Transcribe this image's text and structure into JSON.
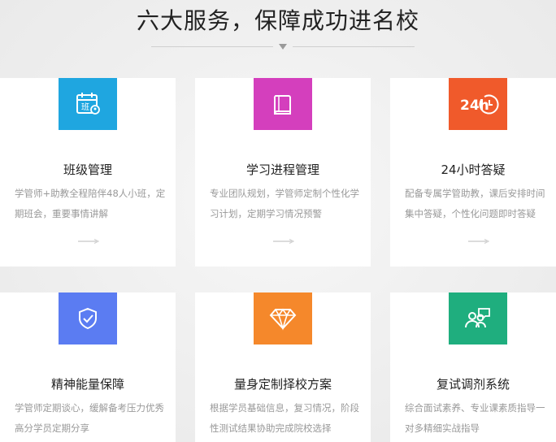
{
  "header": {
    "title": "六大服务，保障成功进名校"
  },
  "colors": {
    "cyan": "#1fa6e0",
    "magenta": "#d43fbd",
    "orange_red": "#f05a2b",
    "blue": "#5b7cf2",
    "orange": "#f5882b",
    "green": "#1fae7e"
  },
  "services": [
    {
      "name": "班级管理",
      "desc": "学管师+助教全程陪伴48人小班，定期班会，重要事情讲解",
      "icon": "class-calendar-icon",
      "icon_text": "班"
    },
    {
      "name": "学习进程管理",
      "desc": "专业团队规划，学管师定制个性化学习计划，定期学习情况预警",
      "icon": "book-icon"
    },
    {
      "name": "24小时答疑",
      "desc": "配备专属学管助教，课后安排时间集中答疑，个性化问题即时答疑",
      "icon": "clock-24h-icon",
      "icon_text": "24h"
    },
    {
      "name": "精神能量保障",
      "desc": "学管师定期谈心，缓解备考压力优秀高分学员定期分享",
      "icon": "shield-check-icon"
    },
    {
      "name": "量身定制择校方案",
      "desc": "根据学员基础信息，复习情况，阶段性测试结果协助完成院校选择",
      "icon": "diamond-icon"
    },
    {
      "name": "复试调剂系统",
      "desc": "综合面试素养、专业课素质指导一对多精细实战指导",
      "icon": "users-chat-icon"
    }
  ]
}
